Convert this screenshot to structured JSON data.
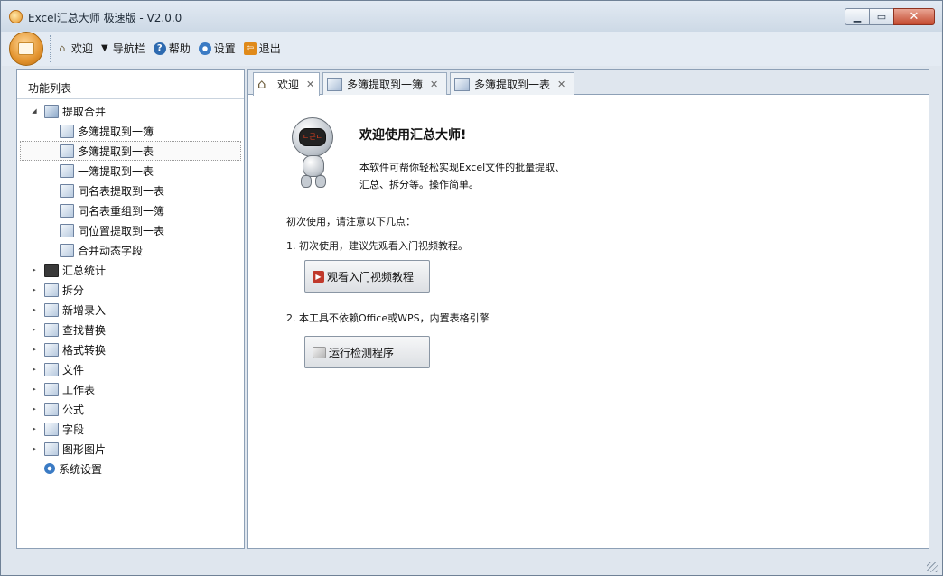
{
  "window": {
    "title": "Excel汇总大师 极速版 - V2.0.0"
  },
  "toolbar": {
    "items": [
      {
        "label": "欢迎",
        "icon": "home-icon"
      },
      {
        "label": "导航栏",
        "icon": "dropdown-arrow-icon"
      },
      {
        "label": "帮助",
        "icon": "help-icon"
      },
      {
        "label": "设置",
        "icon": "gear-icon"
      },
      {
        "label": "退出",
        "icon": "exit-icon"
      }
    ]
  },
  "sidebar": {
    "title": "功能列表",
    "groups": [
      {
        "label": "提取合并",
        "expanded": true,
        "children": [
          {
            "label": "多簿提取到一簿"
          },
          {
            "label": "多簿提取到一表",
            "selected": true
          },
          {
            "label": "一簿提取到一表"
          },
          {
            "label": "同名表提取到一表"
          },
          {
            "label": "同名表重组到一簿"
          },
          {
            "label": "同位置提取到一表"
          },
          {
            "label": "合并动态字段"
          }
        ]
      },
      {
        "label": "汇总统计"
      },
      {
        "label": "拆分"
      },
      {
        "label": "新增录入"
      },
      {
        "label": "查找替换"
      },
      {
        "label": "格式转换"
      },
      {
        "label": "文件"
      },
      {
        "label": "工作表"
      },
      {
        "label": "公式"
      },
      {
        "label": "字段"
      },
      {
        "label": "图形图片"
      },
      {
        "label": "系统设置"
      }
    ]
  },
  "tabs": [
    {
      "label": "欢迎",
      "active": true
    },
    {
      "label": "多簿提取到一簿"
    },
    {
      "label": "多簿提取到一表"
    }
  ],
  "welcome": {
    "title": "欢迎使用汇总大师!",
    "desc_line1": "本软件可帮你轻松实现Excel文件的批量提取、",
    "desc_line2": "汇总、拆分等。操作简单。",
    "notes_title": "初次使用，请注意以下几点：",
    "note1": "1. 初次使用，建议先观看入门视频教程。",
    "video_button": "观看入门视频教程",
    "note2": "2. 本工具不依赖Office或WPS，内置表格引擎",
    "check_button": "运行检测程序",
    "robot_visor": "ㄷ근ㄷ"
  }
}
